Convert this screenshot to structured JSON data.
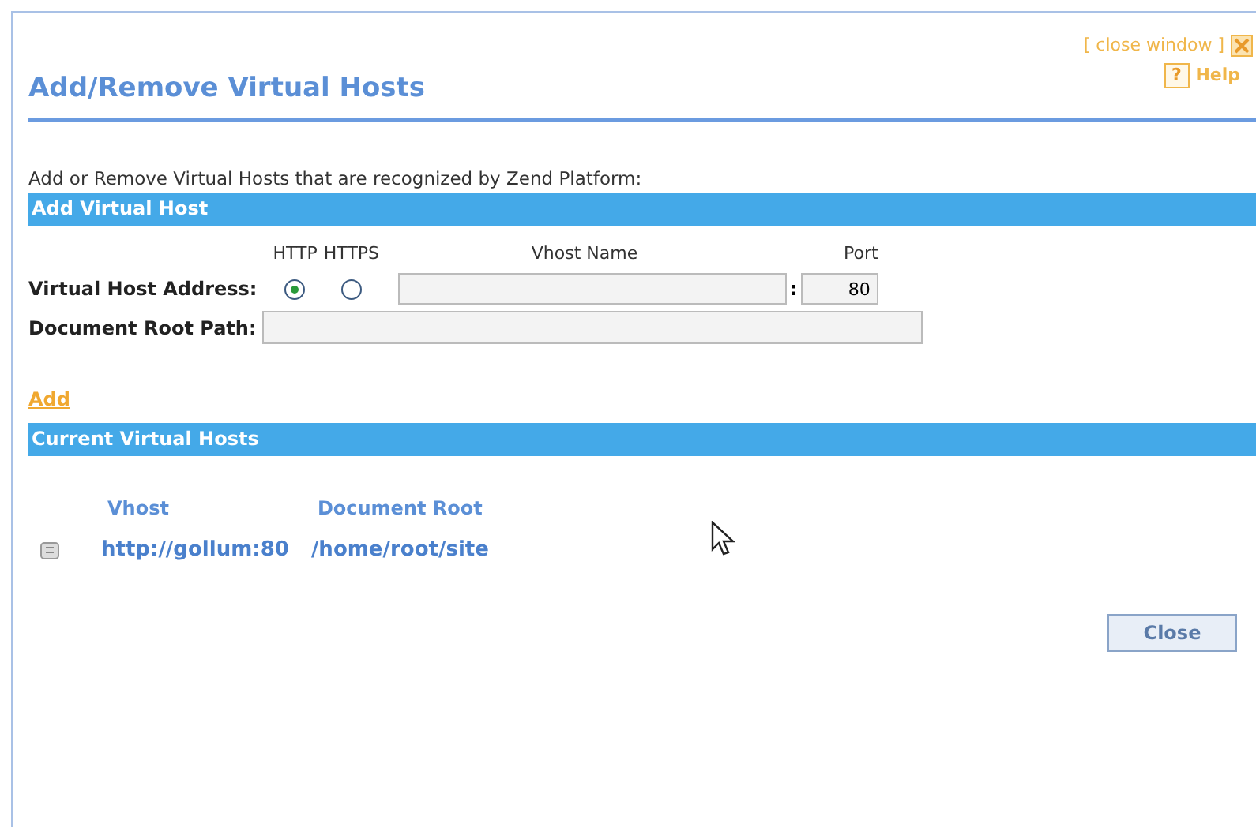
{
  "top_links": {
    "close_window": "[ close window ]",
    "help_icon": "?",
    "help": "Help"
  },
  "title": "Add/Remove Virtual Hosts",
  "description": "Add or Remove Virtual Hosts that are recognized by Zend Platform:",
  "add_section": {
    "heading": "Add Virtual Host",
    "protocols": [
      {
        "label": "HTTP",
        "selected": true
      },
      {
        "label": "HTTPS",
        "selected": false
      }
    ],
    "vhost_name_label": "Vhost Name",
    "port_label": "Port",
    "separator": ":",
    "address_label": "Virtual Host Address:",
    "port_value": "80",
    "root_label": "Document Root Path:",
    "add_link": "Add"
  },
  "current_section": {
    "heading": "Current Virtual Hosts",
    "columns": [
      "Vhost",
      "Document Root"
    ],
    "rows": [
      {
        "vhost": "http://gollum:80",
        "root": "/home/root/site"
      }
    ]
  },
  "close_button": "Close"
}
